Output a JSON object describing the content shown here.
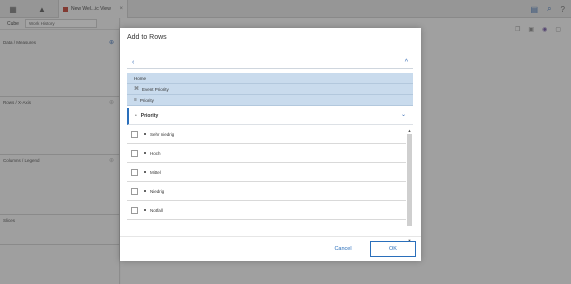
{
  "app": {
    "tab_title": "New Wel...ic View",
    "tab_close": "×",
    "cube_label": "Cube",
    "cube_value": "Work History",
    "sections": {
      "data_measures": "Data / Measures",
      "rows_axis": "Rows / X-Axis",
      "columns_legend": "Columns / Legend",
      "slices": "Slices"
    },
    "topbar_icons": [
      "grid-icon",
      "logo-icon",
      "save-icon",
      "search-icon",
      "help-icon"
    ],
    "help_glyph": "?"
  },
  "dialog": {
    "title": "Add to Rows",
    "back_glyph": "‹",
    "collapse_glyph": "^",
    "breadcrumbs": [
      {
        "label": "Home",
        "icon": ""
      },
      {
        "label": "Event Priority",
        "icon": "hierarchy-icon"
      },
      {
        "label": "Priority",
        "icon": "level-icon"
      }
    ],
    "group": {
      "label": "Priority",
      "chevron": "⌄"
    },
    "items": [
      {
        "label": "Sehr niedrig",
        "checked": false
      },
      {
        "label": "Hoch",
        "checked": false
      },
      {
        "label": "Mittel",
        "checked": false
      },
      {
        "label": "Niedrig",
        "checked": false
      },
      {
        "label": "Notfall",
        "checked": false
      }
    ],
    "cancel_label": "Cancel",
    "ok_label": "OK"
  },
  "colors": {
    "accent": "#2a6fbb",
    "breadcrumb_bg": "#c9dbed",
    "overlay": "rgba(60,60,60,0.47)"
  }
}
